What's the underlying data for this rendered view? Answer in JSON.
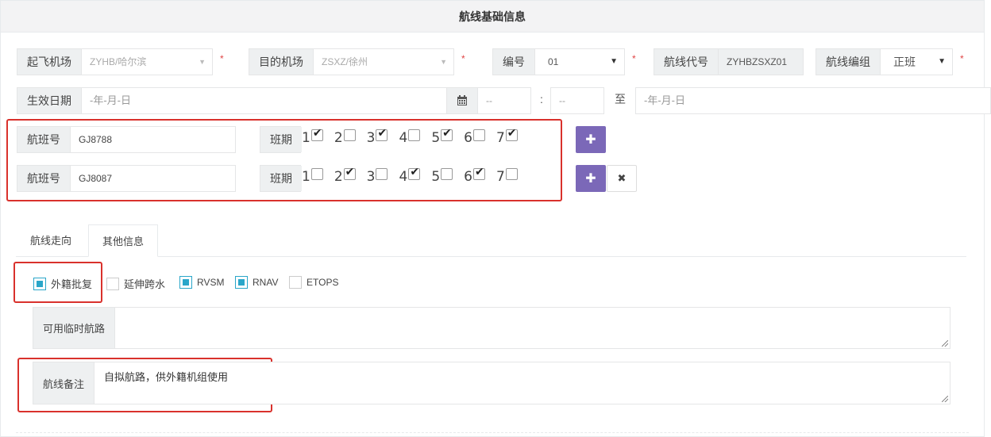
{
  "panel": {
    "title": "航线基础信息"
  },
  "row1": {
    "departure": {
      "label": "起飞机场",
      "value": "ZYHB/哈尔滨"
    },
    "destination": {
      "label": "目的机场",
      "value": "ZSXZ/徐州"
    },
    "number": {
      "label": "编号",
      "value": "01"
    },
    "route_code": {
      "label": "航线代号",
      "value": "ZYHBZSXZ01"
    },
    "route_group": {
      "label": "航线编组",
      "value": "正班"
    },
    "required_mark": "*"
  },
  "row2": {
    "effective_date": {
      "label": "生效日期",
      "placeholder": "-年-月-日"
    },
    "hour": "--",
    "minute": "--",
    "colon": ":",
    "to_label": "至",
    "end_date_placeholder": "-年-月-日"
  },
  "flights": [
    {
      "label": "航班号",
      "value": "GJ8788",
      "schedule_label": "班期",
      "days": [
        {
          "n": "1",
          "on": true
        },
        {
          "n": "2",
          "on": false
        },
        {
          "n": "3",
          "on": true
        },
        {
          "n": "4",
          "on": false
        },
        {
          "n": "5",
          "on": true
        },
        {
          "n": "6",
          "on": false
        },
        {
          "n": "7",
          "on": true
        }
      ]
    },
    {
      "label": "航班号",
      "value": "GJ8087",
      "schedule_label": "班期",
      "days": [
        {
          "n": "1",
          "on": false
        },
        {
          "n": "2",
          "on": true
        },
        {
          "n": "3",
          "on": false
        },
        {
          "n": "4",
          "on": true
        },
        {
          "n": "5",
          "on": false
        },
        {
          "n": "6",
          "on": true
        },
        {
          "n": "7",
          "on": false
        }
      ]
    }
  ],
  "tabs": [
    {
      "label": "航线走向",
      "active": false
    },
    {
      "label": "其他信息",
      "active": true
    }
  ],
  "options": [
    {
      "label": "外籍批复",
      "checked": true
    },
    {
      "label": "延伸跨水",
      "checked": false
    },
    {
      "label": "RVSM",
      "checked": true
    },
    {
      "label": "RNAV",
      "checked": true
    },
    {
      "label": "ETOPS",
      "checked": false
    }
  ],
  "temp_route": {
    "label": "可用临时航路",
    "value": ""
  },
  "remarks": {
    "label": "航线备注",
    "value": "自拟航路，供外籍机组使用"
  },
  "colors": {
    "accent": "#7b68b8",
    "highlight": "#d9312c",
    "check": "#2aa6c9"
  }
}
